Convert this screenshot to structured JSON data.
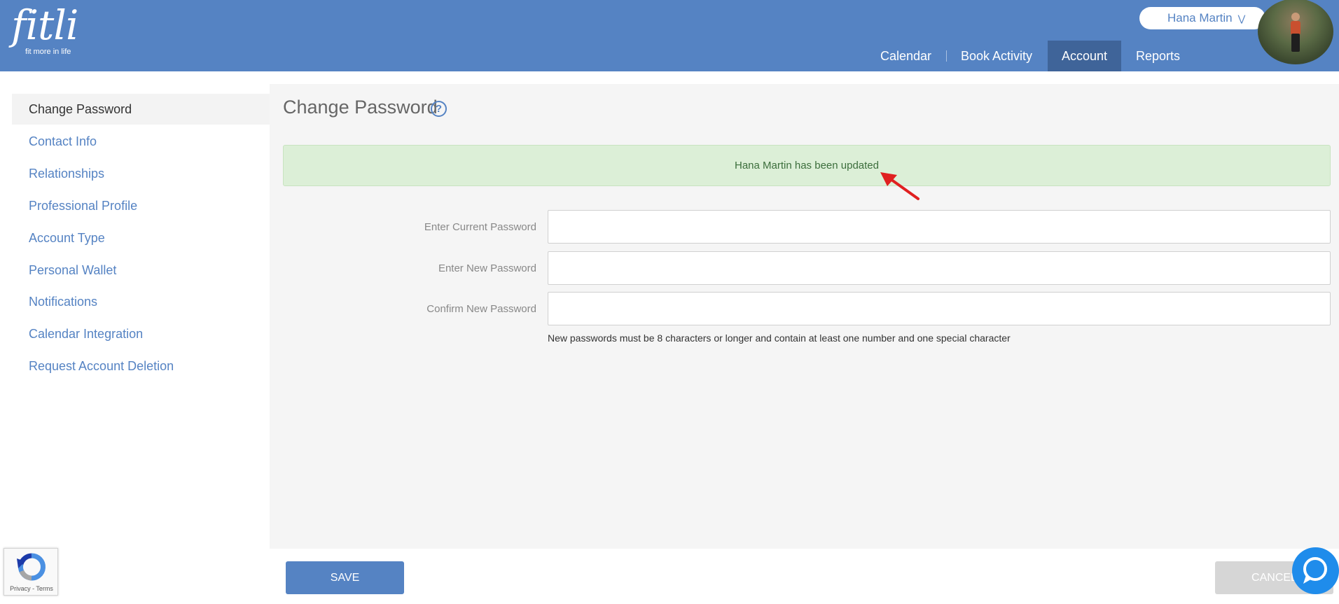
{
  "logo": {
    "word": "fitli",
    "tagline": "fit more in life"
  },
  "user": {
    "name": "Hana Martin",
    "chevron": "»"
  },
  "nav": {
    "calendar": "Calendar",
    "book_activity": "Book Activity",
    "account": "Account",
    "reports": "Reports"
  },
  "sidebar": {
    "items": [
      {
        "label": "Change Password",
        "active": true
      },
      {
        "label": "Contact Info"
      },
      {
        "label": "Relationships"
      },
      {
        "label": "Professional Profile"
      },
      {
        "label": "Account Type"
      },
      {
        "label": "Personal Wallet"
      },
      {
        "label": "Notifications"
      },
      {
        "label": "Calendar Integration"
      },
      {
        "label": "Request Account Deletion"
      }
    ]
  },
  "main": {
    "title": "Change Password",
    "help_glyph": "?",
    "alert": "Hana Martin has been updated",
    "fields": [
      {
        "label": "Enter Current Password",
        "value": ""
      },
      {
        "label": "Enter New Password",
        "value": ""
      },
      {
        "label": "Confirm New Password",
        "value": ""
      }
    ],
    "hint": "New passwords must be 8 characters or longer and contain at least one number and one special character"
  },
  "footer": {
    "save_label": "SAVE",
    "cancel_label": "CANCEL"
  },
  "recaptcha": {
    "links": "Privacy - Terms"
  },
  "colors": {
    "brand": "#5583c3",
    "nav_active": "#3f6499",
    "alert_bg": "#dcefd7",
    "chat": "#1f8ceb"
  }
}
